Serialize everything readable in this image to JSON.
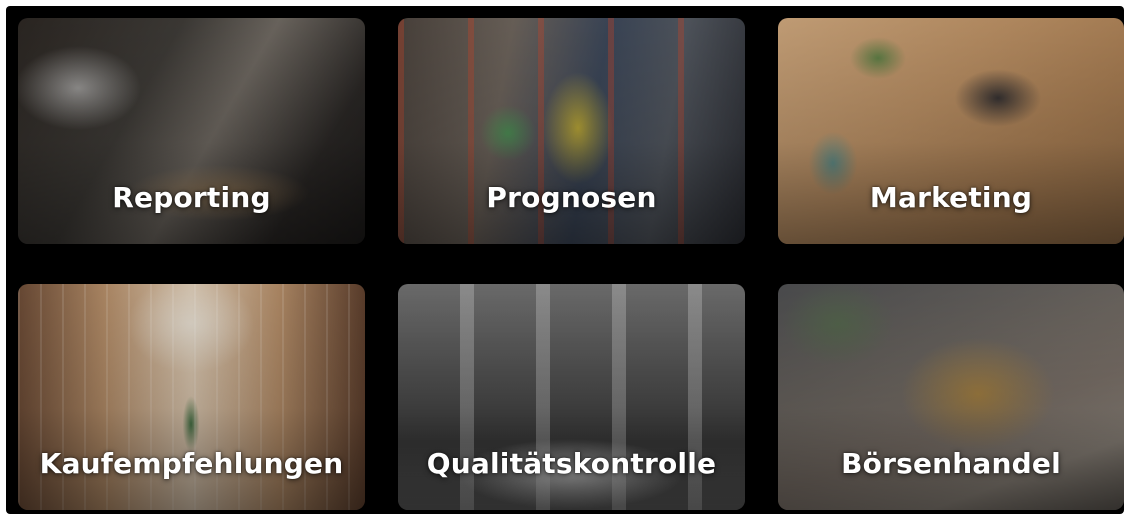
{
  "tiles": [
    {
      "label": "Reporting"
    },
    {
      "label": "Prognosen"
    },
    {
      "label": "Marketing"
    },
    {
      "label": "Kaufempfehlungen"
    },
    {
      "label": "Qualitätskontrolle"
    },
    {
      "label": "Börsenhandel"
    }
  ]
}
